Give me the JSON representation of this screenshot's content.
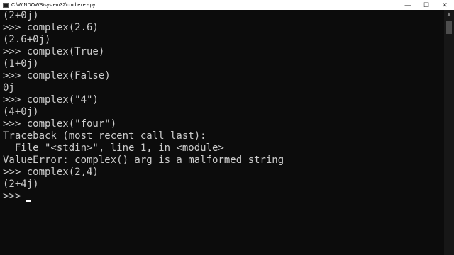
{
  "window": {
    "title": "C:\\WINDOWS\\system32\\cmd.exe - py",
    "icon": "cmd-icon",
    "minimize_glyph": "—",
    "maximize_glyph": "☐",
    "close_glyph": "✕"
  },
  "console": {
    "lines": [
      "(2+0j)",
      ">>> complex(2.6)",
      "(2.6+0j)",
      ">>> complex(True)",
      "(1+0j)",
      ">>> complex(False)",
      "0j",
      ">>> complex(\"4\")",
      "(4+0j)",
      ">>> complex(\"four\")",
      "Traceback (most recent call last):",
      "  File \"<stdin>\", line 1, in <module>",
      "ValueError: complex() arg is a malformed string",
      ">>> complex(2,4)",
      "(2+4j)",
      ">>> "
    ]
  },
  "scrollbar": {
    "up_glyph": "▲"
  },
  "colors": {
    "background": "#0c0c0c",
    "text": "#cccccc",
    "titlebar": "#ffffff"
  }
}
